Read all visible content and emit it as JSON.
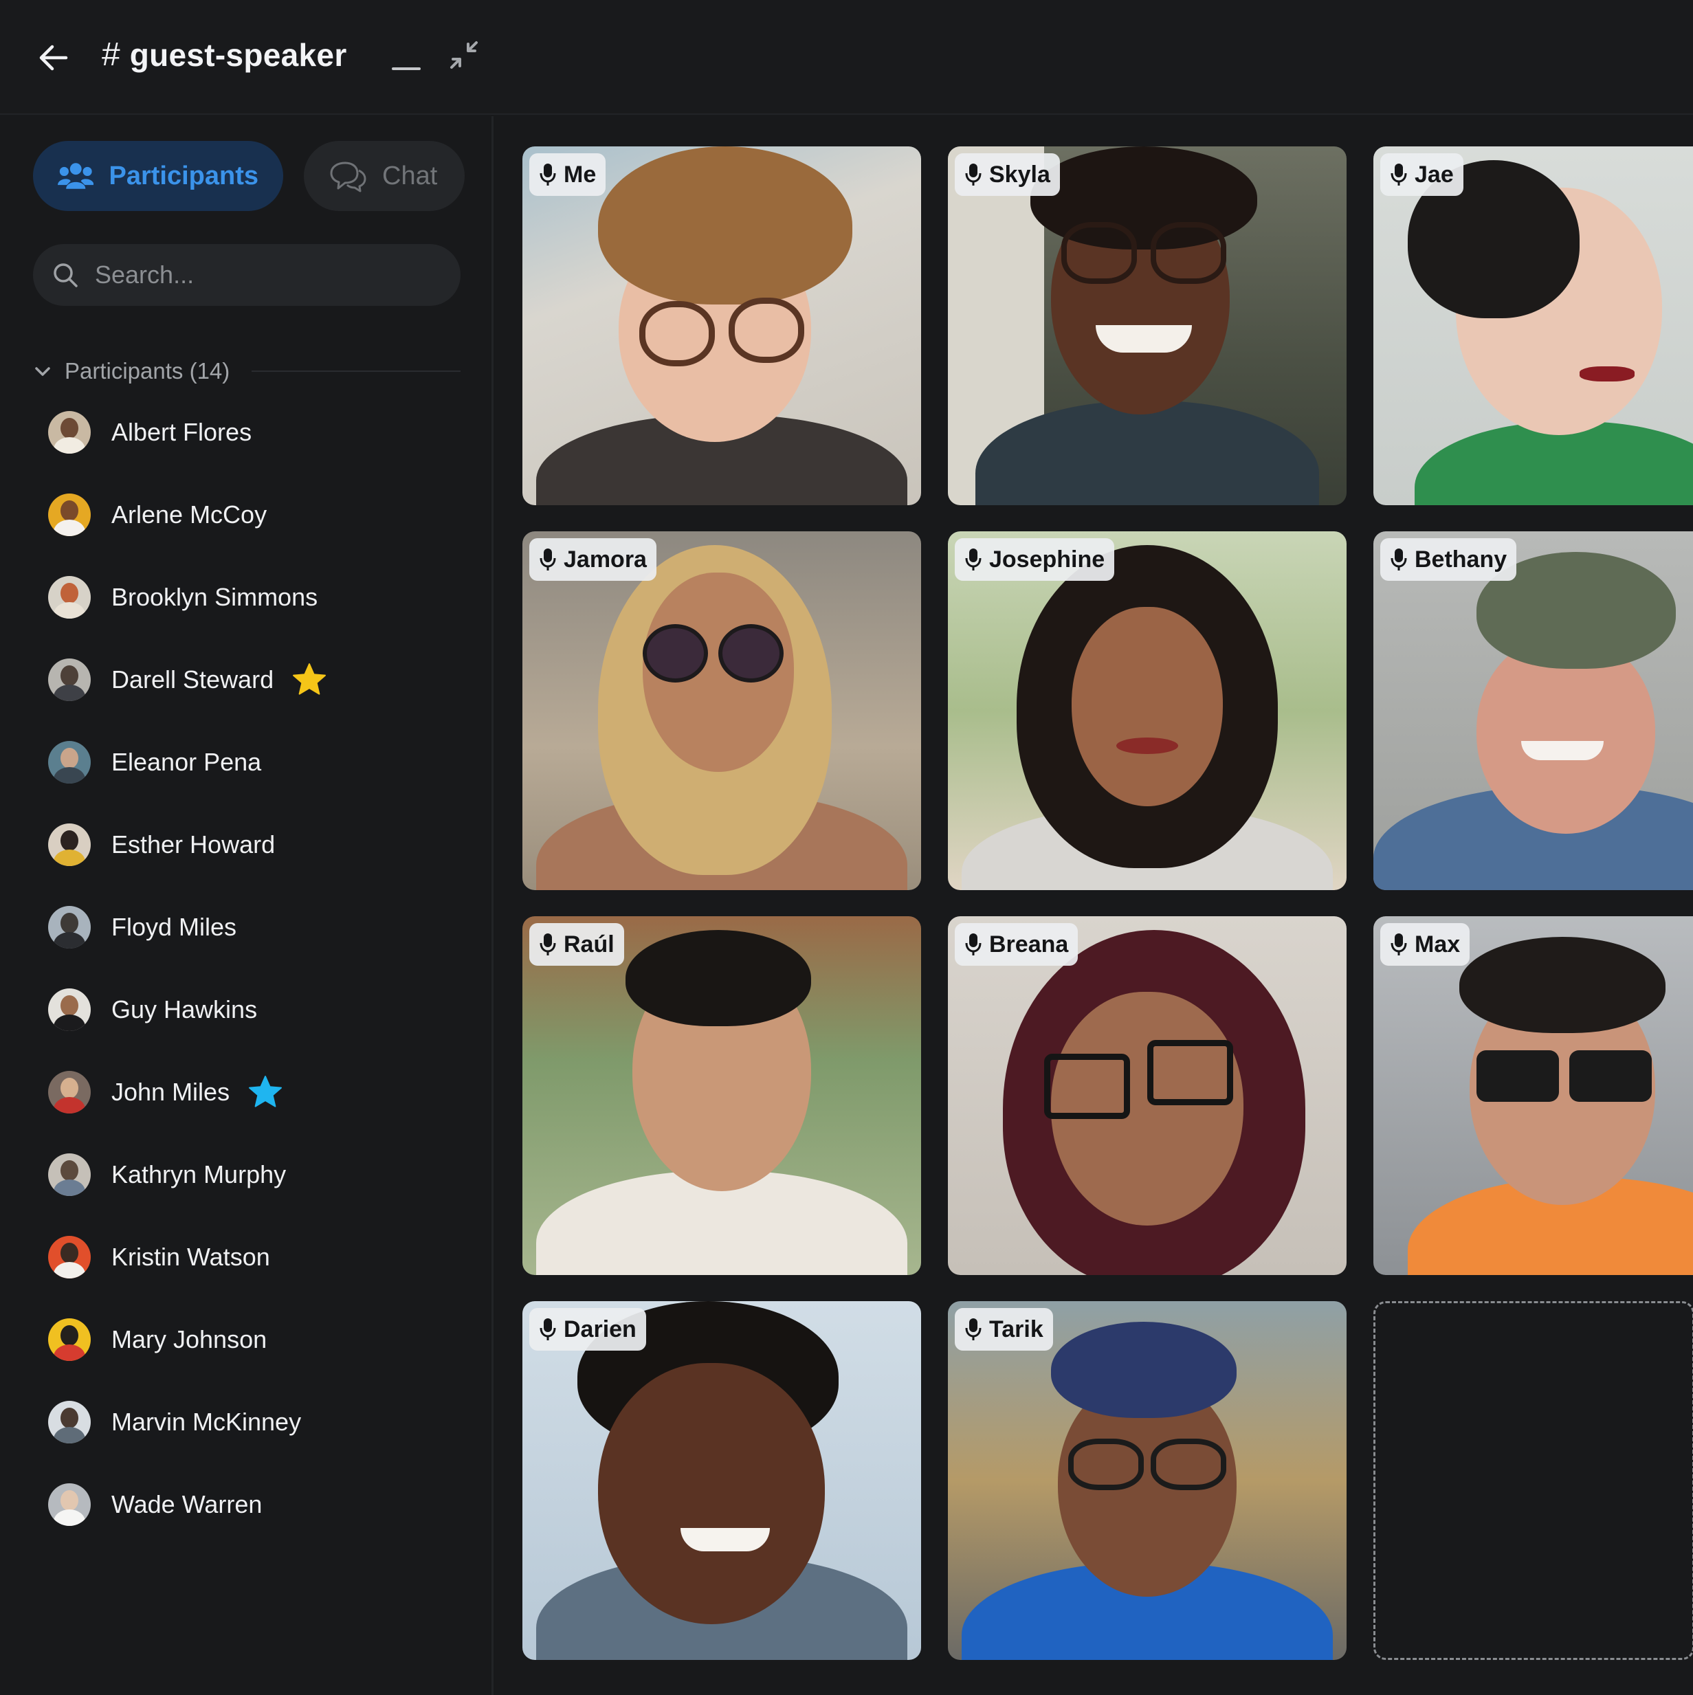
{
  "header": {
    "channel_hash": "#",
    "channel_name": "guest-speaker"
  },
  "tabs": [
    {
      "label": "Participants",
      "active": true
    },
    {
      "label": "Chat",
      "active": false
    }
  ],
  "search": {
    "placeholder": "Search..."
  },
  "participants_section": {
    "title": "Participants (14)"
  },
  "participants": [
    {
      "name": "Albert Flores"
    },
    {
      "name": "Arlene McCoy"
    },
    {
      "name": "Brooklyn Simmons"
    },
    {
      "name": "Darell Steward",
      "star": "yellow-star-icon"
    },
    {
      "name": "Eleanor Pena"
    },
    {
      "name": "Esther Howard"
    },
    {
      "name": "Floyd Miles"
    },
    {
      "name": "Guy Hawkins"
    },
    {
      "name": "John Miles",
      "star": "blue-star-icon"
    },
    {
      "name": "Kathryn Murphy"
    },
    {
      "name": "Kristin Watson"
    },
    {
      "name": "Mary Johnson"
    },
    {
      "name": "Marvin McKinney"
    },
    {
      "name": "Wade Warren"
    }
  ],
  "video_tiles": [
    {
      "name": "Me"
    },
    {
      "name": "Skyla"
    },
    {
      "name": "Jae"
    },
    {
      "name": "Jamora"
    },
    {
      "name": "Josephine"
    },
    {
      "name": "Bethany"
    },
    {
      "name": "Raúl"
    },
    {
      "name": "Breana"
    },
    {
      "name": "Max"
    },
    {
      "name": "Darien"
    },
    {
      "name": "Tarik"
    }
  ],
  "colors": {
    "accent": "#3b93ea",
    "active_tab_bg": "#18304f",
    "star_yellow": "#f5c518",
    "star_blue": "#1fb5f0"
  }
}
